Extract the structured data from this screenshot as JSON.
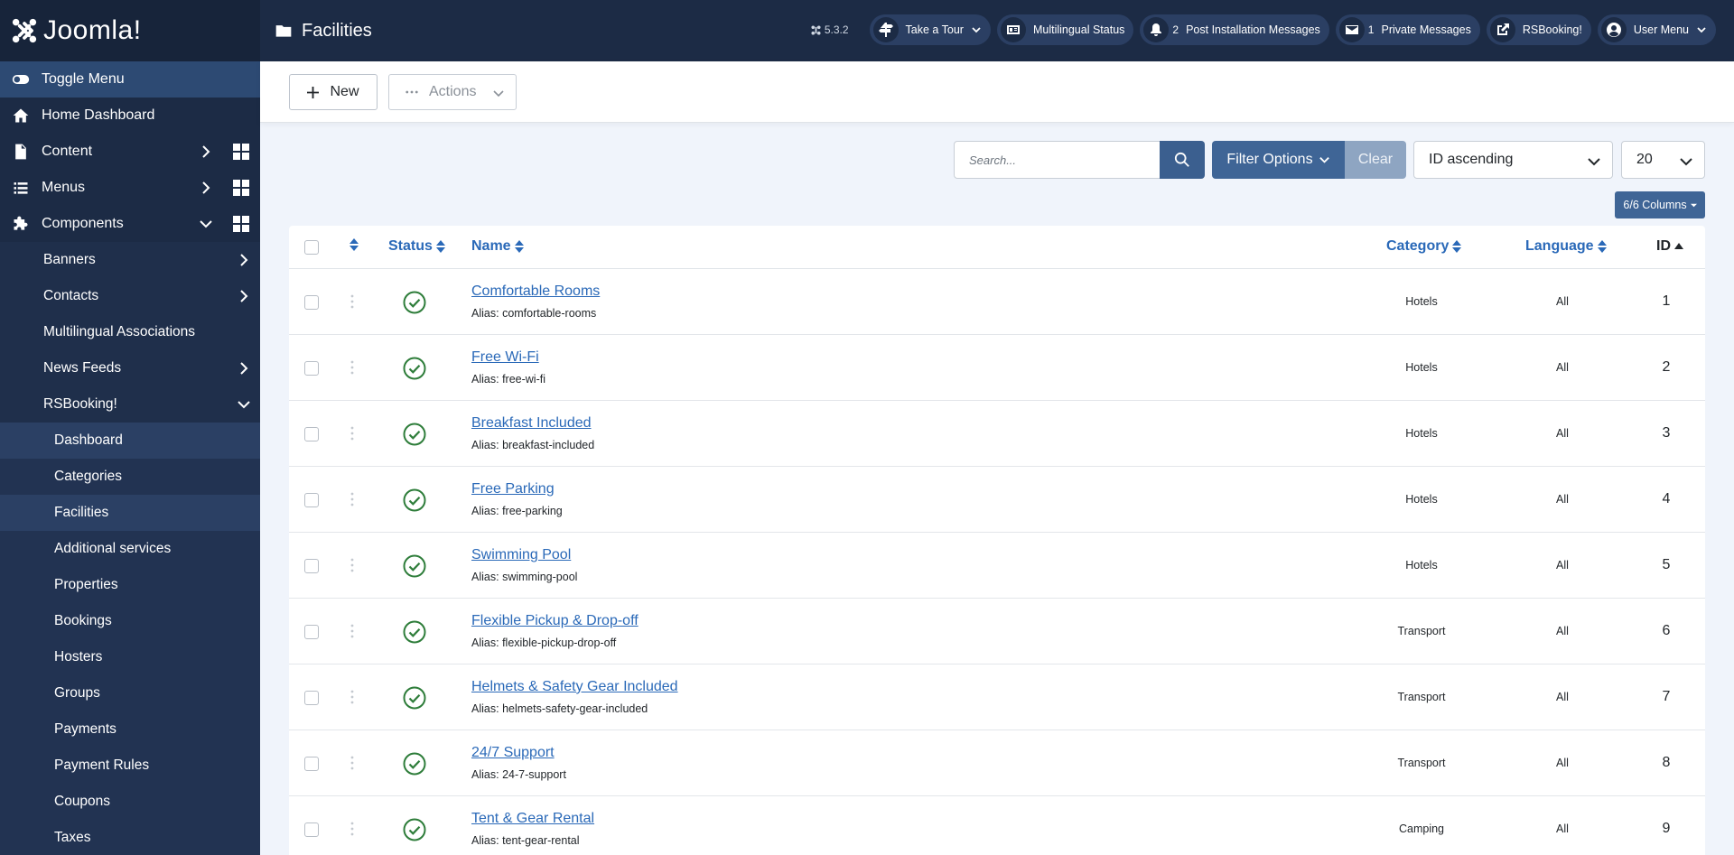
{
  "brand": {
    "name": "Joomla!"
  },
  "header": {
    "title": "Facilities",
    "version": "5.3.2",
    "pills": [
      {
        "label": "Take a Tour",
        "icon": "signpost-icon"
      },
      {
        "label": "Multilingual Status",
        "icon": "language-icon"
      },
      {
        "label": "Post Installation Messages",
        "count": "2",
        "icon": "bell-icon"
      },
      {
        "label": "Private Messages",
        "count": "1",
        "icon": "envelope-icon"
      },
      {
        "label": "RSBooking!",
        "icon": "external-link-icon"
      },
      {
        "label": "User Menu",
        "icon": "user-icon"
      }
    ]
  },
  "sidebar": {
    "toggle": "Toggle Menu",
    "home": "Home Dashboard",
    "content": "Content",
    "menus": "Menus",
    "components": "Components",
    "components_items": [
      "Banners",
      "Contacts",
      "Multilingual Associations",
      "News Feeds",
      "RSBooking!"
    ],
    "rsbooking_items": [
      "Dashboard",
      "Categories",
      "Facilities",
      "Additional services",
      "Properties",
      "Bookings",
      "Hosters",
      "Groups",
      "Payments",
      "Payment Rules",
      "Coupons",
      "Taxes"
    ]
  },
  "toolbar": {
    "new_label": "New",
    "actions_label": "Actions"
  },
  "filters": {
    "search_placeholder": "Search...",
    "filter_label": "Filter Options",
    "clear_label": "Clear",
    "ordering": "ID ascending",
    "limit": "20",
    "columns_label": "6/6 Columns"
  },
  "table": {
    "headers": {
      "status": "Status",
      "name": "Name",
      "category": "Category",
      "language": "Language",
      "id": "ID"
    },
    "alias_prefix": "Alias:",
    "rows": [
      {
        "name": "Comfortable Rooms",
        "alias": "comfortable-rooms",
        "category": "Hotels",
        "language": "All",
        "id": "1"
      },
      {
        "name": "Free Wi-Fi",
        "alias": "free-wi-fi",
        "category": "Hotels",
        "language": "All",
        "id": "2"
      },
      {
        "name": "Breakfast Included",
        "alias": "breakfast-included",
        "category": "Hotels",
        "language": "All",
        "id": "3"
      },
      {
        "name": "Free Parking",
        "alias": "free-parking",
        "category": "Hotels",
        "language": "All",
        "id": "4"
      },
      {
        "name": "Swimming Pool",
        "alias": "swimming-pool",
        "category": "Hotels",
        "language": "All",
        "id": "5"
      },
      {
        "name": "Flexible Pickup & Drop-off",
        "alias": "flexible-pickup-drop-off",
        "category": "Transport",
        "language": "All",
        "id": "6"
      },
      {
        "name": "Helmets & Safety Gear Included",
        "alias": "helmets-safety-gear-included",
        "category": "Transport",
        "language": "All",
        "id": "7"
      },
      {
        "name": "24/7 Support",
        "alias": "24-7-support",
        "category": "Transport",
        "language": "All",
        "id": "8"
      },
      {
        "name": "Tent & Gear Rental",
        "alias": "tent-gear-rental",
        "category": "Camping",
        "language": "All",
        "id": "9"
      }
    ]
  }
}
